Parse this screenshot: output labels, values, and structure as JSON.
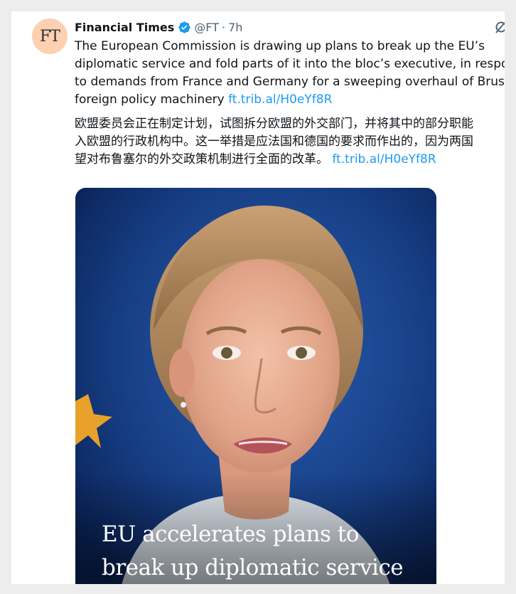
{
  "tweet": {
    "avatar_text": "FT",
    "author_name": "Financial Times",
    "handle": "@FT",
    "separator": "·",
    "time": "7h",
    "text_en_lines": [
      "The European Commission is drawing up plans to break up the EU’s",
      "diplomatic service and fold parts of it into the bloc’s executive, in respo",
      "to demands from France and Germany for a sweeping overhaul of Bruss",
      "foreign policy machinery"
    ],
    "text_en_link": "ft.trib.al/H0eYf8R",
    "text_zh_lines": [
      "欧盟委员会正在制定计划，试图拆分欧盟的外交部门，并将其中的部分职能",
      "入欧盟的行政机构中。这一举措是应法国和德国的要求而作出的，因为两国",
      "望对布鲁塞尔的外交政策机制进行全面的改革。"
    ],
    "text_zh_link": "ft.trib.al/H0eYf8R"
  },
  "card": {
    "headline_lines": [
      "EU accelerates plans to",
      "break up diplomatic service"
    ]
  },
  "colors": {
    "link": "#1d9bf0",
    "verified": "#1d9bf0",
    "avatar_bg": "#fcd0b1",
    "secondary_text": "#536471"
  },
  "icons": {
    "verified": "verified-badge-icon",
    "grok": "grok-icon"
  }
}
